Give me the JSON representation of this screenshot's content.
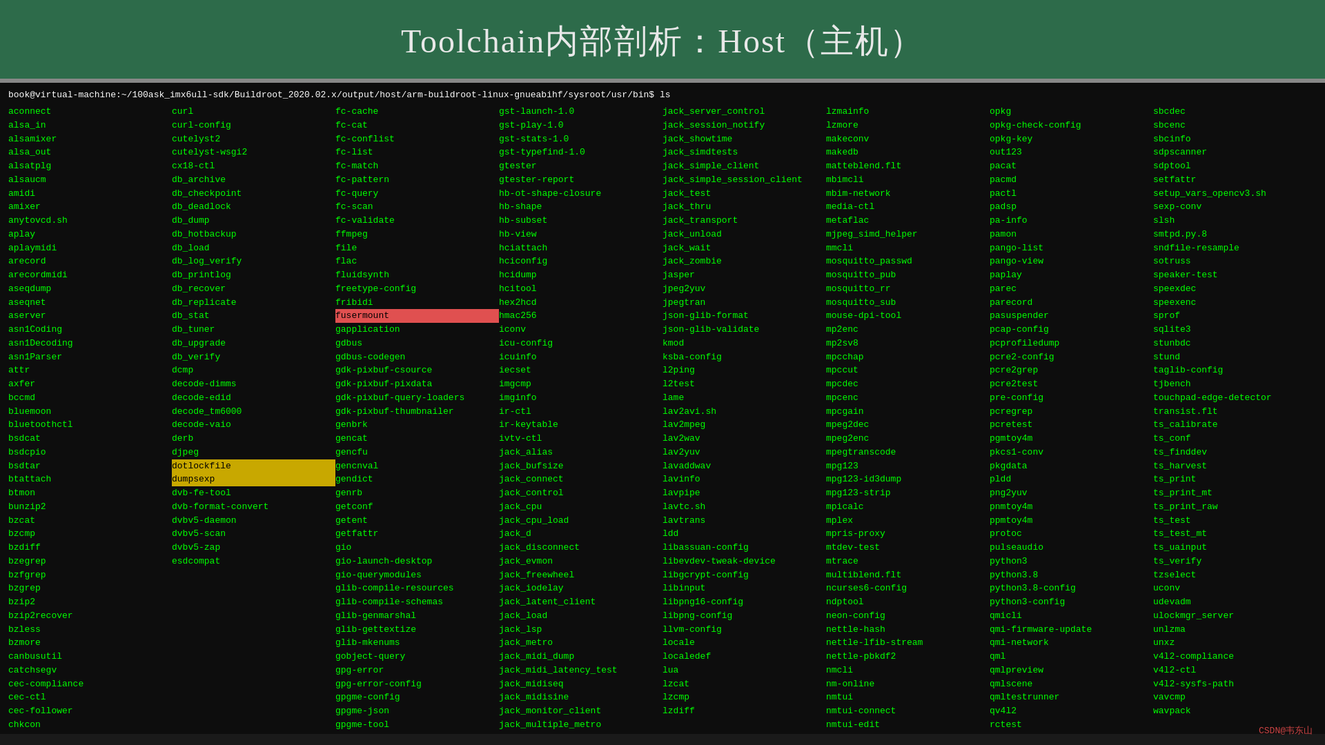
{
  "header": {
    "title": "Toolchain内部剖析：Host（主机）"
  },
  "terminal": {
    "cmd": "book@virtual-machine:~/100ask_imx6ull-sdk/Buildroot_2020.02.x/output/host/arm-buildroot-linux-gnueabihf/sysroot/usr/bin$ ls",
    "columns": [
      [
        "aconnect",
        "alsa_in",
        "alsamixer",
        "alsa_out",
        "alsatplg",
        "alsaucm",
        "amidi",
        "amixer",
        "anytovcd.sh",
        "aplay",
        "aplaymidi",
        "arecord",
        "arecordmidi",
        "aseqdump",
        "aseqnet",
        "aserver",
        "asn1Coding",
        "asn1Decoding",
        "asn1Parser",
        "attr",
        "axfer",
        "bccmd",
        "bluemoon",
        "bluetoothctl",
        "bsdcat",
        "bsdcpio",
        "bsdtar",
        "btattach",
        "btmon",
        "bunzip2",
        "bzcat",
        "bzcmp",
        "bzdiff",
        "bzegrep",
        "bzfgrep",
        "bzgrep",
        "bzip2",
        "bzip2recover",
        "bzless",
        "bzmore",
        "canbusutil",
        "catchsegv",
        "cec-compliance",
        "cec-ctl",
        "cec-follower",
        "chkcon"
      ],
      [
        "curl",
        "curl-config",
        "cutelyst2",
        "cutelyst-wsgi2",
        "cx18-ctl",
        "db_archive",
        "db_checkpoint",
        "db_deadlock",
        "db_dump",
        "db_hotbackup",
        "db_load",
        "db_log_verify",
        "db_printlog",
        "db_recover",
        "db_replicate",
        "db_stat",
        "db_tuner",
        "db_upgrade",
        "db_verify",
        "dcmp",
        "decode-dimms",
        "decode-edid",
        "decode_tm6000",
        "decode-vaio",
        "derb",
        "djpeg",
        "dotlockfile",
        "dumpsexp",
        "dvb-fe-tool",
        "dvb-format-convert",
        "dvbv5-daemon",
        "dvbv5-scan",
        "dvbv5-zap",
        "esdcompat"
      ],
      [
        "fc-cache",
        "fc-cat",
        "fc-conflist",
        "fc-list",
        "fc-match",
        "fc-pattern",
        "fc-query",
        "fc-scan",
        "fc-validate",
        "ffmpeg",
        "file",
        "flac",
        "fluidsynth",
        "freetype-config",
        "fribidi",
        "fusermount",
        "gapplication",
        "gdbus",
        "gdbus-codegen",
        "gdk-pixbuf-csource",
        "gdk-pixbuf-pixdata",
        "gdk-pixbuf-query-loaders",
        "gdk-pixbuf-thumbnailer",
        "genbrk",
        "gencat",
        "gencfu",
        "gencnval",
        "gendict",
        "genrb",
        "getconf",
        "getent",
        "getfattr",
        "gio",
        "gio-launch-desktop",
        "gio-querymodules",
        "glib-compile-resources",
        "glib-compile-schemas",
        "glib-genmarshal",
        "glib-gettextize",
        "glib-mkenums",
        "gobject-query",
        "gpg-error",
        "gpg-error-config",
        "gpgme-config",
        "gpgme-json",
        "gpgme-tool"
      ],
      [
        "gst-launch-1.0",
        "gst-play-1.0",
        "gst-stats-1.0",
        "gst-typefind-1.0",
        "gtester",
        "gtester-report",
        "hb-ot-shape-closure",
        "hb-shape",
        "hb-subset",
        "hb-view",
        "hciattach",
        "hciconfig",
        "hcidump",
        "hcitool",
        "hex2hcd",
        "hmac256",
        "iconv",
        "icu-config",
        "icuinfo",
        "iecset",
        "imgcmp",
        "imginfo",
        "ir-ctl",
        "ir-keytable",
        "ivtv-ctl",
        "jack_alias",
        "jack_bufsize",
        "jack_connect",
        "jack_control",
        "jack_cpu",
        "jack_cpu_load",
        "jack_d",
        "jack_disconnect",
        "jack_evmon",
        "jack_freewheel",
        "jack_iodelay",
        "jack_latent_client",
        "jack_load",
        "jack_lsp",
        "jack_metro",
        "jack_midi_dump",
        "jack_midi_latency_test",
        "jack_midiseq",
        "jack_midisine",
        "jack_monitor_client",
        "jack_multiple_metro"
      ],
      [
        "jack_server_control",
        "jack_session_notify",
        "jack_showtime",
        "jack_simdtests",
        "jack_simple_client",
        "jack_simple_session_client",
        "jack_test",
        "jack_thru",
        "jack_transport",
        "jack_unload",
        "jack_wait",
        "jack_zombie",
        "jasper",
        "jpeg2yuv",
        "jpegtran",
        "json-glib-format",
        "json-glib-validate",
        "kmod",
        "ksba-config",
        "l2ping",
        "l2test",
        "lame",
        "lav2avi.sh",
        "lav2mpeg",
        "lav2wav",
        "lav2yuv",
        "lavaddwav",
        "lavinfo",
        "lavpipe",
        "lavtc.sh",
        "lavtrans",
        "ldd",
        "libassuan-config",
        "libevdev-tweak-device",
        "libgcrypt-config",
        "libinput",
        "libpng16-config",
        "libpng-config",
        "llvm-config",
        "locale",
        "localedef",
        "lua",
        "lzcat",
        "lzcmp",
        "lzdiff"
      ],
      [
        "lzmainfo",
        "lzmore",
        "makeconv",
        "makedb",
        "matteblend.flt",
        "mbimcli",
        "mbim-network",
        "media-ctl",
        "metaflac",
        "mjpeg_simd_helper",
        "mmcli",
        "mosquitto_passwd",
        "mosquitto_pub",
        "mosquitto_rr",
        "mosquitto_sub",
        "mouse-dpi-tool",
        "mp2enc",
        "mp2sv8",
        "mpcchap",
        "mpccut",
        "mpcdec",
        "mpcenc",
        "mpcgain",
        "mpeg2dec",
        "mpeg2enc",
        "mpegtranscode",
        "mpg123",
        "mpg123-id3dump",
        "mpg123-strip",
        "mpicalc",
        "mplex",
        "mpris-proxy",
        "mtdev-test",
        "mtrace",
        "multiblend.flt",
        "ncurses6-config",
        "ndptool",
        "neon-config",
        "nettle-hash",
        "nettle-lfib-stream",
        "nettle-pbkdf2",
        "nmcli",
        "nm-online",
        "nmtui",
        "nmtui-connect",
        "nmtui-edit"
      ],
      [
        "opkg",
        "opkg-check-config",
        "opkg-key",
        "out123",
        "pacat",
        "pacmd",
        "pactl",
        "padsp",
        "pa-info",
        "pamon",
        "pango-list",
        "pango-view",
        "paplay",
        "parec",
        "parecord",
        "pasuspender",
        "pcap-config",
        "pcprofiledump",
        "pcre2-config",
        "pcre2grep",
        "pcre2test",
        "pre-config",
        "pcregrep",
        "pcretest",
        "pgmtoy4m",
        "pkcs1-conv",
        "pkgdata",
        "pldd",
        "png2yuv",
        "pnmtoy4m",
        "ppmtoy4m",
        "protoc",
        "pulseaudio",
        "python3",
        "python3.8",
        "python3.8-config",
        "python3-config",
        "qmicli",
        "qmi-firmware-update",
        "qmi-network",
        "qml",
        "qmlpreview",
        "qmlscene",
        "qmltestrunner",
        "qv4l2",
        "rctest"
      ],
      [
        "sbcdec",
        "sbcenc",
        "sbcinfo",
        "sdpscanner",
        "sdptool",
        "setfattr",
        "setup_vars_opencv3.sh",
        "sexp-conv",
        "slsh",
        "smtpd.py.8",
        "sndfile-resample",
        "sotruss",
        "speaker-test",
        "speexdec",
        "speexenc",
        "sprof",
        "sqlite3",
        "stunbdc",
        "stund",
        "taglib-config",
        "tjbench",
        "touchpad-edge-detector",
        "transist.flt",
        "ts_calibrate",
        "ts_conf",
        "ts_finddev",
        "ts_harvest",
        "ts_print",
        "ts_print_mt",
        "ts_print_raw",
        "ts_test",
        "ts_test_mt",
        "ts_uainput",
        "ts_verify",
        "tzselect",
        "uconv",
        "udevadm",
        "ulockmgr_server",
        "unlzma",
        "unxz",
        "v4l2-compliance",
        "v4l2-ctl",
        "v4l2-sysfs-path",
        "vavcmp",
        "wavpack"
      ]
    ],
    "highlighted": {
      "fusermount": "red",
      "dotlockfile": "yellow",
      "dumpsexp": "yellow"
    }
  },
  "watermark": "CSDN@韦东山"
}
